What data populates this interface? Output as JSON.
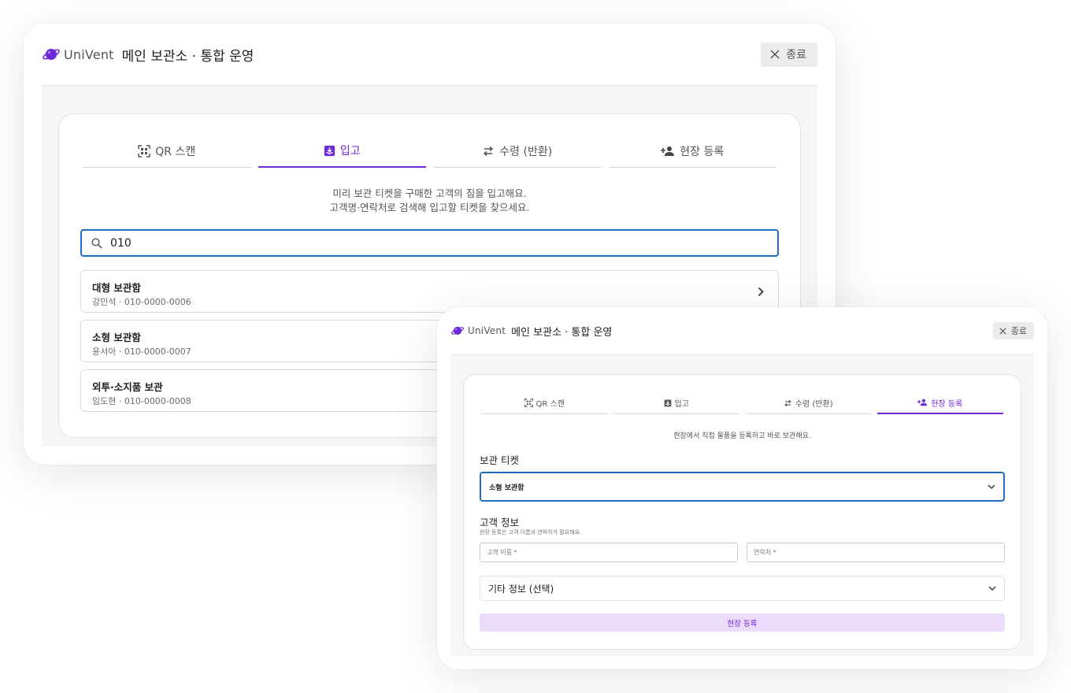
{
  "app": {
    "brand": "UniVent",
    "title": "메인 보관소 · 통합 운영",
    "close_label": "종료"
  },
  "colors": {
    "accent": "#6d28d9",
    "focus": "#1e6fc2"
  },
  "tabs": [
    {
      "label": "QR 스캔",
      "icon": "qr-scan-icon"
    },
    {
      "label": "입고",
      "icon": "inbox-arrow-icon"
    },
    {
      "label": "수령 (반환)",
      "icon": "swap-arrows-icon"
    },
    {
      "label": "현장 등록",
      "icon": "person-add-icon"
    }
  ],
  "checkin": {
    "desc_line1": "미리 보관 티켓을 구매한 고객의 짐을 입고해요.",
    "desc_line2": "고객명·연락처로 검색해 입고할 티켓을 찾으세요.",
    "search_value": "010",
    "results": [
      {
        "title": "대형 보관함",
        "subtitle": "강민석 · 010-0000-0006"
      },
      {
        "title": "소형 보관함",
        "subtitle": "윤서아 · 010-0000-0007"
      },
      {
        "title": "외투·소지품 보관",
        "subtitle": "임도현 · 010-0000-0008"
      }
    ]
  },
  "onsite": {
    "desc": "현장에서 직접 물품을 등록하고 바로 보관해요.",
    "ticket_section": "보관 티켓",
    "ticket_selected": "소형 보관함",
    "customer_section": "고객 정보",
    "customer_hint": "현장 등록은 고객 이름과 연락처가 필요해요.",
    "name_label": "고객 이름 *",
    "phone_label": "연락처 *",
    "extra_section": "기타 정보 (선택)",
    "submit_label": "현장 등록"
  }
}
